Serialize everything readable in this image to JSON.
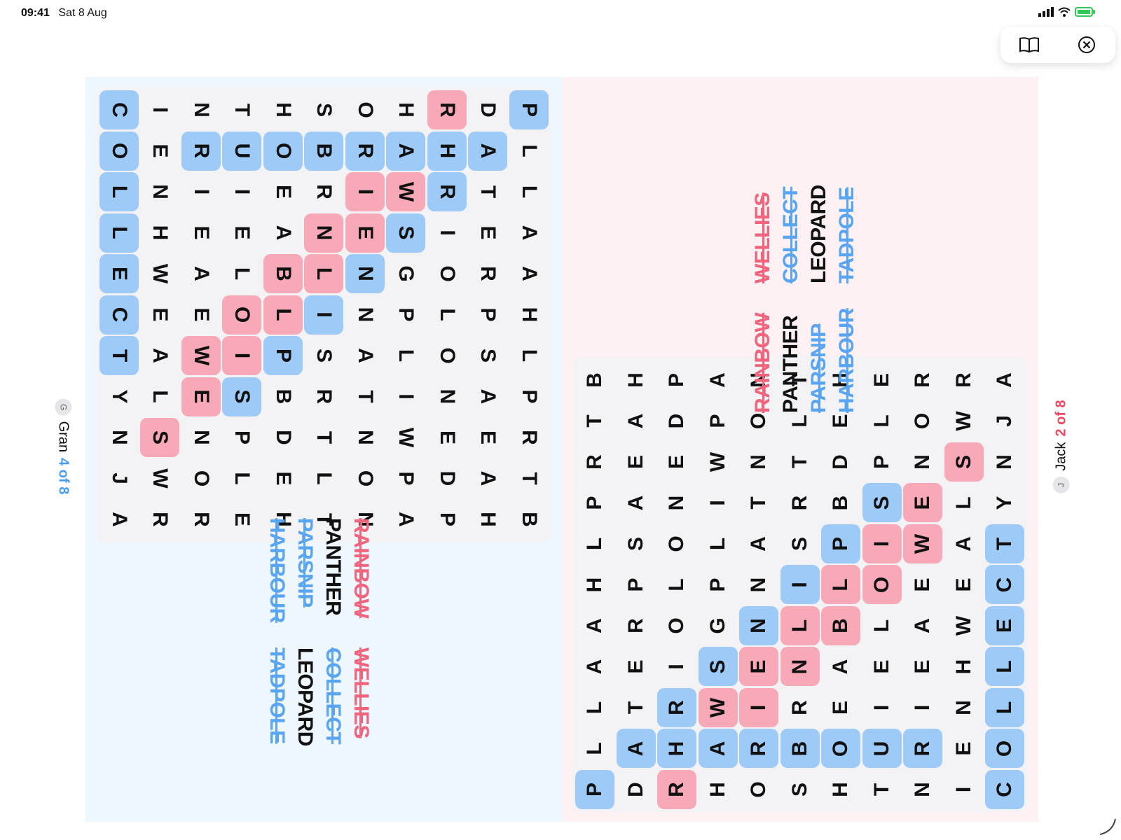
{
  "status_bar": {
    "time": "09:41",
    "date": "Sat 8 Aug"
  },
  "toolbar": {
    "book_icon": "book-icon",
    "close_icon": "close-circle-icon"
  },
  "colors": {
    "gran": "#9ecaf7",
    "jack": "#f7a9b7",
    "gran_bg": "#eef6fe",
    "jack_bg": "#fdf1f3"
  },
  "players": {
    "gran": {
      "initial": "G",
      "name": "Gran",
      "score": "4 of 8"
    },
    "jack": {
      "initial": "J",
      "name": "Jack",
      "score": "2 of 8"
    }
  },
  "grid": [
    "PLLAAHLPRTB",
    "DATERPSAEAH",
    "RHRIOLONEDP",
    "HAWSGPLIWPA",
    "ORIENNATNON",
    "SBRNLISRTLT",
    "HOEABLPBDEH",
    "TUIELOISPLE",
    "NRIEAEWENOR",
    "IENHWEALSWR",
    "COLLECTYNJA"
  ],
  "highlights": [
    "BBBBBBBBB....",
    ".BBBBBBBBB.",
    "PBB.......",
    "..PP.......",
    "....PB.....",
    "........"
  ],
  "marks": [
    [
      "B",
      ".",
      ".",
      ".",
      ".",
      ".",
      ".",
      ".",
      ".",
      ".",
      "."
    ],
    [
      ".",
      "B",
      ".",
      ".",
      ".",
      ".",
      ".",
      ".",
      ".",
      ".",
      "."
    ],
    [
      "P",
      "B",
      "B",
      ".",
      ".",
      ".",
      ".",
      ".",
      ".",
      ".",
      "."
    ],
    [
      ".",
      "B",
      "P",
      "B",
      ".",
      ".",
      ".",
      ".",
      ".",
      ".",
      "."
    ],
    [
      ".",
      "B",
      "P",
      "P",
      "B",
      ".",
      ".",
      ".",
      ".",
      ".",
      "."
    ],
    [
      ".",
      "B",
      ".",
      "P",
      "P",
      "B",
      ".",
      ".",
      ".",
      ".",
      "."
    ],
    [
      ".",
      "B",
      ".",
      ".",
      "P",
      "P",
      "B",
      ".",
      ".",
      ".",
      "."
    ],
    [
      ".",
      "B",
      ".",
      ".",
      ".",
      "P",
      "P",
      "B",
      ".",
      ".",
      "."
    ],
    [
      ".",
      "B",
      ".",
      ".",
      ".",
      ".",
      "P",
      "P",
      ".",
      ".",
      "."
    ],
    [
      ".",
      ".",
      ".",
      ".",
      ".",
      ".",
      ".",
      ".",
      "P",
      ".",
      "."
    ],
    [
      "B",
      "B",
      "B",
      "B",
      "B",
      "B",
      "B",
      ".",
      ".",
      ".",
      "."
    ]
  ],
  "words": [
    {
      "text": "RAINBOW",
      "state": "found-pink"
    },
    {
      "text": "WELLIES",
      "state": "found-pink"
    },
    {
      "text": "PANTHER",
      "state": "pending"
    },
    {
      "text": "COLLECT",
      "state": "found-blue"
    },
    {
      "text": "PARSNIP",
      "state": "found-blue"
    },
    {
      "text": "LEOPARD",
      "state": "pending"
    },
    {
      "text": "HARBOUR",
      "state": "found-blue"
    },
    {
      "text": "TADPOLE",
      "state": "found-blue"
    }
  ]
}
